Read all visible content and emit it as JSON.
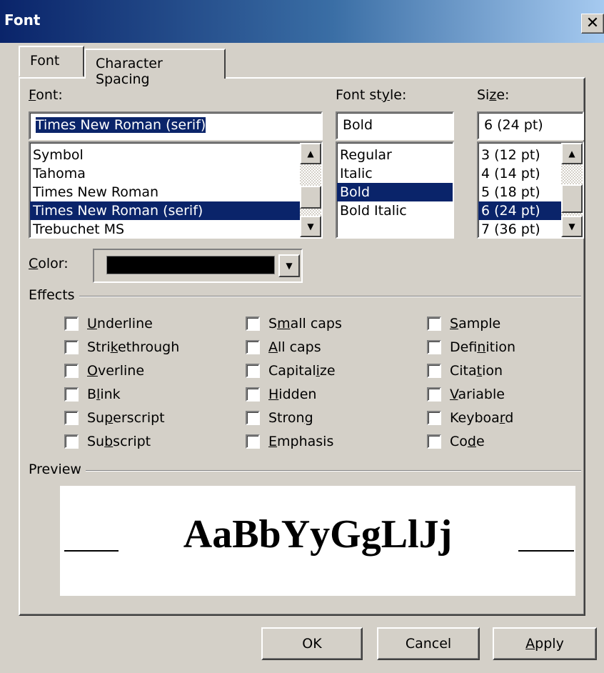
{
  "window": {
    "title": "Font",
    "close_glyph": "✕"
  },
  "tabs": [
    {
      "label": "Font",
      "active": true
    },
    {
      "label": "Character Spacing",
      "active": false
    }
  ],
  "font": {
    "label_prefix": "",
    "label_accel": "F",
    "label_rest": "ont:",
    "value": "Times New Roman (serif)",
    "items": [
      "Symbol",
      "Tahoma",
      "Times New Roman",
      "Times New Roman (serif)",
      "Trebuchet MS"
    ],
    "selected_index": 3
  },
  "style": {
    "label_prefix": "Font st",
    "label_accel": "y",
    "label_rest": "le:",
    "value": "Bold",
    "items": [
      "Regular",
      "Italic",
      "Bold",
      "Bold Italic"
    ],
    "selected_index": 2
  },
  "size": {
    "label_prefix": "Si",
    "label_accel": "z",
    "label_rest": "e:",
    "value": "6  (24 pt)",
    "items": [
      "3  (12 pt)",
      "4  (14 pt)",
      "5  (18 pt)",
      "6  (24 pt)",
      "7  (36 pt)"
    ],
    "selected_index": 3
  },
  "color": {
    "label_accel": "C",
    "label_rest": "olor:",
    "value_hex": "#000000"
  },
  "effects": {
    "heading": "Effects",
    "col1": [
      {
        "pre": "",
        "accel": "U",
        "post": "nderline"
      },
      {
        "pre": "Stri",
        "accel": "k",
        "post": "ethrough"
      },
      {
        "pre": "",
        "accel": "O",
        "post": "verline"
      },
      {
        "pre": "B",
        "accel": "l",
        "post": "ink"
      },
      {
        "pre": "Su",
        "accel": "p",
        "post": "erscript"
      },
      {
        "pre": "Su",
        "accel": "b",
        "post": "script"
      }
    ],
    "col2": [
      {
        "pre": "S",
        "accel": "m",
        "post": "all caps"
      },
      {
        "pre": "",
        "accel": "A",
        "post": "ll caps"
      },
      {
        "pre": "Capital",
        "accel": "i",
        "post": "ze"
      },
      {
        "pre": "",
        "accel": "H",
        "post": "idden"
      },
      {
        "pre": "Stron",
        "accel": "g",
        "post": ""
      },
      {
        "pre": "",
        "accel": "E",
        "post": "mphasis"
      }
    ],
    "col3": [
      {
        "pre": "",
        "accel": "S",
        "post": "ample"
      },
      {
        "pre": "Defi",
        "accel": "n",
        "post": "ition"
      },
      {
        "pre": "Cita",
        "accel": "t",
        "post": "ion"
      },
      {
        "pre": "",
        "accel": "V",
        "post": "ariable"
      },
      {
        "pre": "Keyboa",
        "accel": "r",
        "post": "d"
      },
      {
        "pre": "Co",
        "accel": "d",
        "post": "e"
      }
    ]
  },
  "preview": {
    "heading": "Preview",
    "sample": "AaBbYyGgLlJj"
  },
  "buttons": {
    "ok": "OK",
    "cancel": "Cancel",
    "apply_accel": "A",
    "apply_rest": "pply"
  }
}
